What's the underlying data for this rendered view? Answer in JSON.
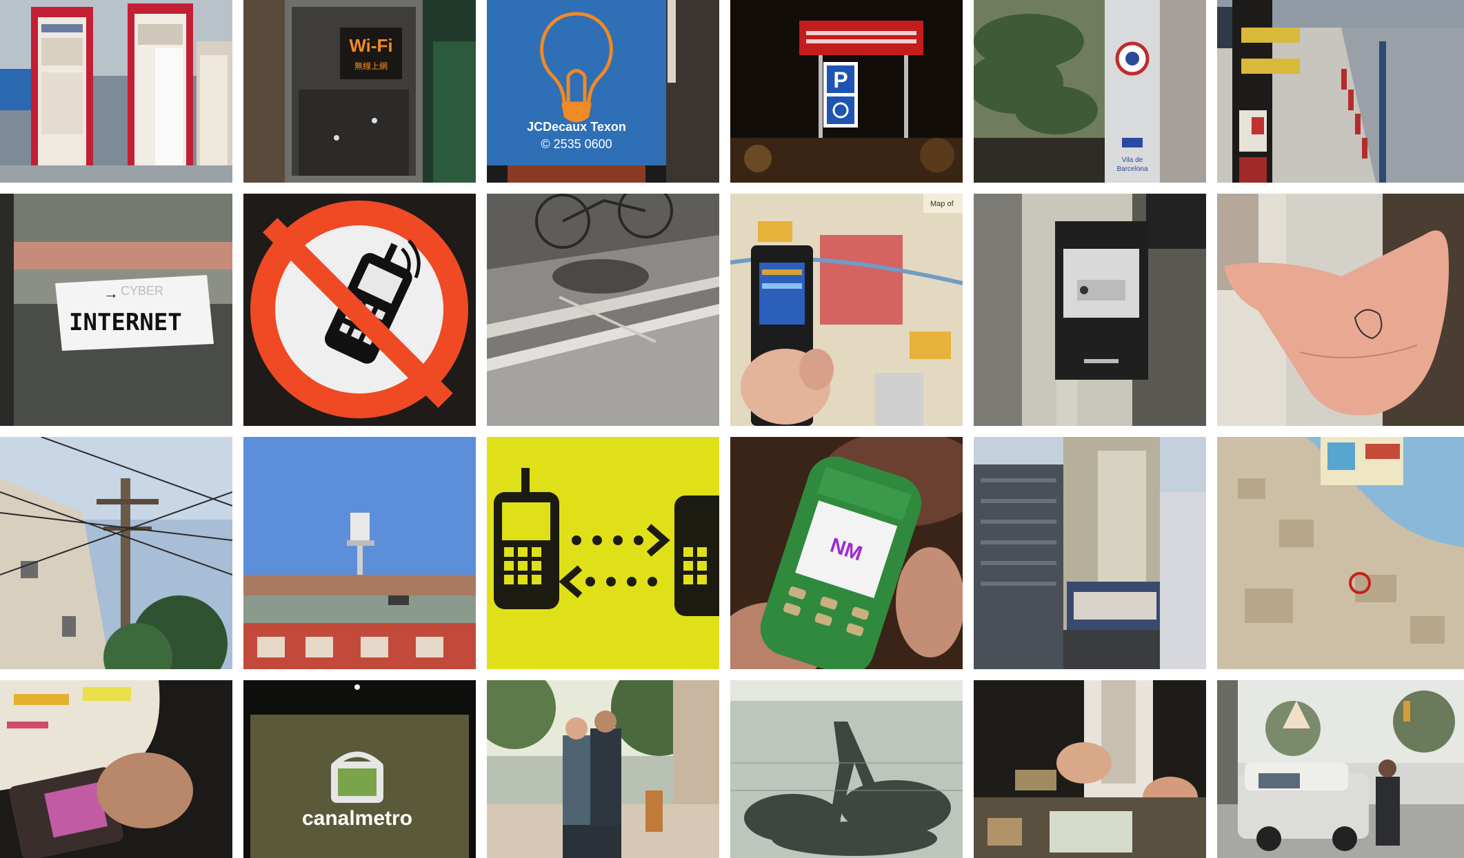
{
  "gallery": {
    "rows": 4,
    "columns": 6,
    "tiles": [
      {
        "id": "t1",
        "subject": "bus stop information panels"
      },
      {
        "id": "t2",
        "subject": "wifi kiosk booth",
        "text": [
          "Wi-Fi",
          "無線上網"
        ]
      },
      {
        "id": "t3",
        "subject": "lightbulb billboard",
        "text": [
          "JCDecaux Texon",
          "© 2535 0600"
        ]
      },
      {
        "id": "t4",
        "subject": "night parking sign",
        "text": [
          "P"
        ]
      },
      {
        "id": "t5",
        "subject": "palm tree and info pillar",
        "text": [
          "Vila de",
          "Barcelona"
        ]
      },
      {
        "id": "t6",
        "subject": "bicycle docking station"
      },
      {
        "id": "t7",
        "subject": "internet sign on step",
        "text": [
          "CYBER",
          "INTERNET"
        ]
      },
      {
        "id": "t8",
        "subject": "no mobile phones sign"
      },
      {
        "id": "t9",
        "subject": "bike shadow on pavement"
      },
      {
        "id": "t10",
        "subject": "phone held over city map",
        "text": [
          "Map of"
        ]
      },
      {
        "id": "t11",
        "subject": "wall mounted info panel"
      },
      {
        "id": "t12",
        "subject": "drawing on palm of hand"
      },
      {
        "id": "t13",
        "subject": "telephone pole and wires"
      },
      {
        "id": "t14",
        "subject": "antenna on rooftop"
      },
      {
        "id": "t15",
        "subject": "phone to phone transfer icon"
      },
      {
        "id": "t16",
        "subject": "green patterned mobile phone",
        "text": [
          "NM"
        ]
      },
      {
        "id": "t17",
        "subject": "tall building with banner"
      },
      {
        "id": "t18",
        "subject": "coastal city map"
      },
      {
        "id": "t19",
        "subject": "phone screen near poster"
      },
      {
        "id": "t20",
        "subject": "canal metro screen",
        "text": [
          "canalmetro"
        ]
      },
      {
        "id": "t21",
        "subject": "people on street"
      },
      {
        "id": "t22",
        "subject": "tree shadow on wall"
      },
      {
        "id": "t23",
        "subject": "person writing at counter"
      },
      {
        "id": "t24",
        "subject": "car parked on street"
      }
    ]
  }
}
